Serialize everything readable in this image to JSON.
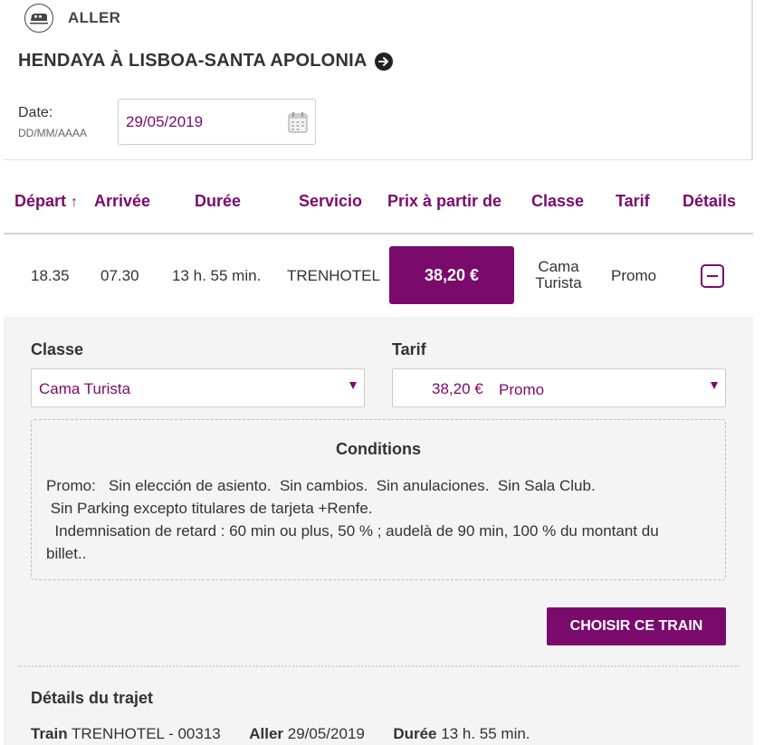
{
  "header": {
    "direction_label": "ALLER",
    "route_title": "HENDAYA À LISBOA-SANTA APOLONIA",
    "date_label": "Date:",
    "date_format": "DD/MM/AAAA",
    "date_value": "29/05/2019"
  },
  "table": {
    "columns": [
      "Départ",
      "Arrivée",
      "Durée",
      "Servicio",
      "Prix à partir de",
      "Classe",
      "Tarif",
      "Détails"
    ],
    "sort_indicator": "↑",
    "row": {
      "depart": "18.35",
      "arrivee": "07.30",
      "duree": "13 h. 55 min.",
      "servicio": "TRENHOTEL",
      "prix": "38,20 €",
      "classe_line1": "Cama",
      "classe_line2": "Turista",
      "tarif": "Promo"
    }
  },
  "detail": {
    "classe_label": "Classe",
    "classe_value": "Cama Turista",
    "tarif_label": "Tarif",
    "tarif_price": "38,20 €",
    "tarif_name": "Promo",
    "conditions_title": "Conditions",
    "conditions_lines": [
      "Promo:   Sin elección de asiento.  Sin cambios.  Sin anulaciones.  Sin Sala Club.",
      " Sin Parking excepto titulares de tarjeta +Renfe.",
      "  Indemnisation de retard : 60 min ou plus, 50 % ; audelà de 90 min, 100 % du montant du",
      "billet.."
    ],
    "choose_button": "CHOISIR CE TRAIN",
    "trip_title": "Détails du trajet",
    "trip": {
      "train_label": "Train",
      "train_value": "TRENHOTEL - 00313",
      "aller_label": "Aller",
      "aller_value": "29/05/2019",
      "duree_label": "Durée",
      "duree_value": "13 h. 55 min."
    }
  },
  "colors": {
    "accent": "#7b0a6d",
    "panel": "#f4f4f4"
  },
  "icons": [
    "train-icon",
    "arrow-right-circle-icon",
    "calendar-icon",
    "collapse-minus-icon",
    "sort-up-arrow-icon",
    "dropdown-caret-icon"
  ]
}
